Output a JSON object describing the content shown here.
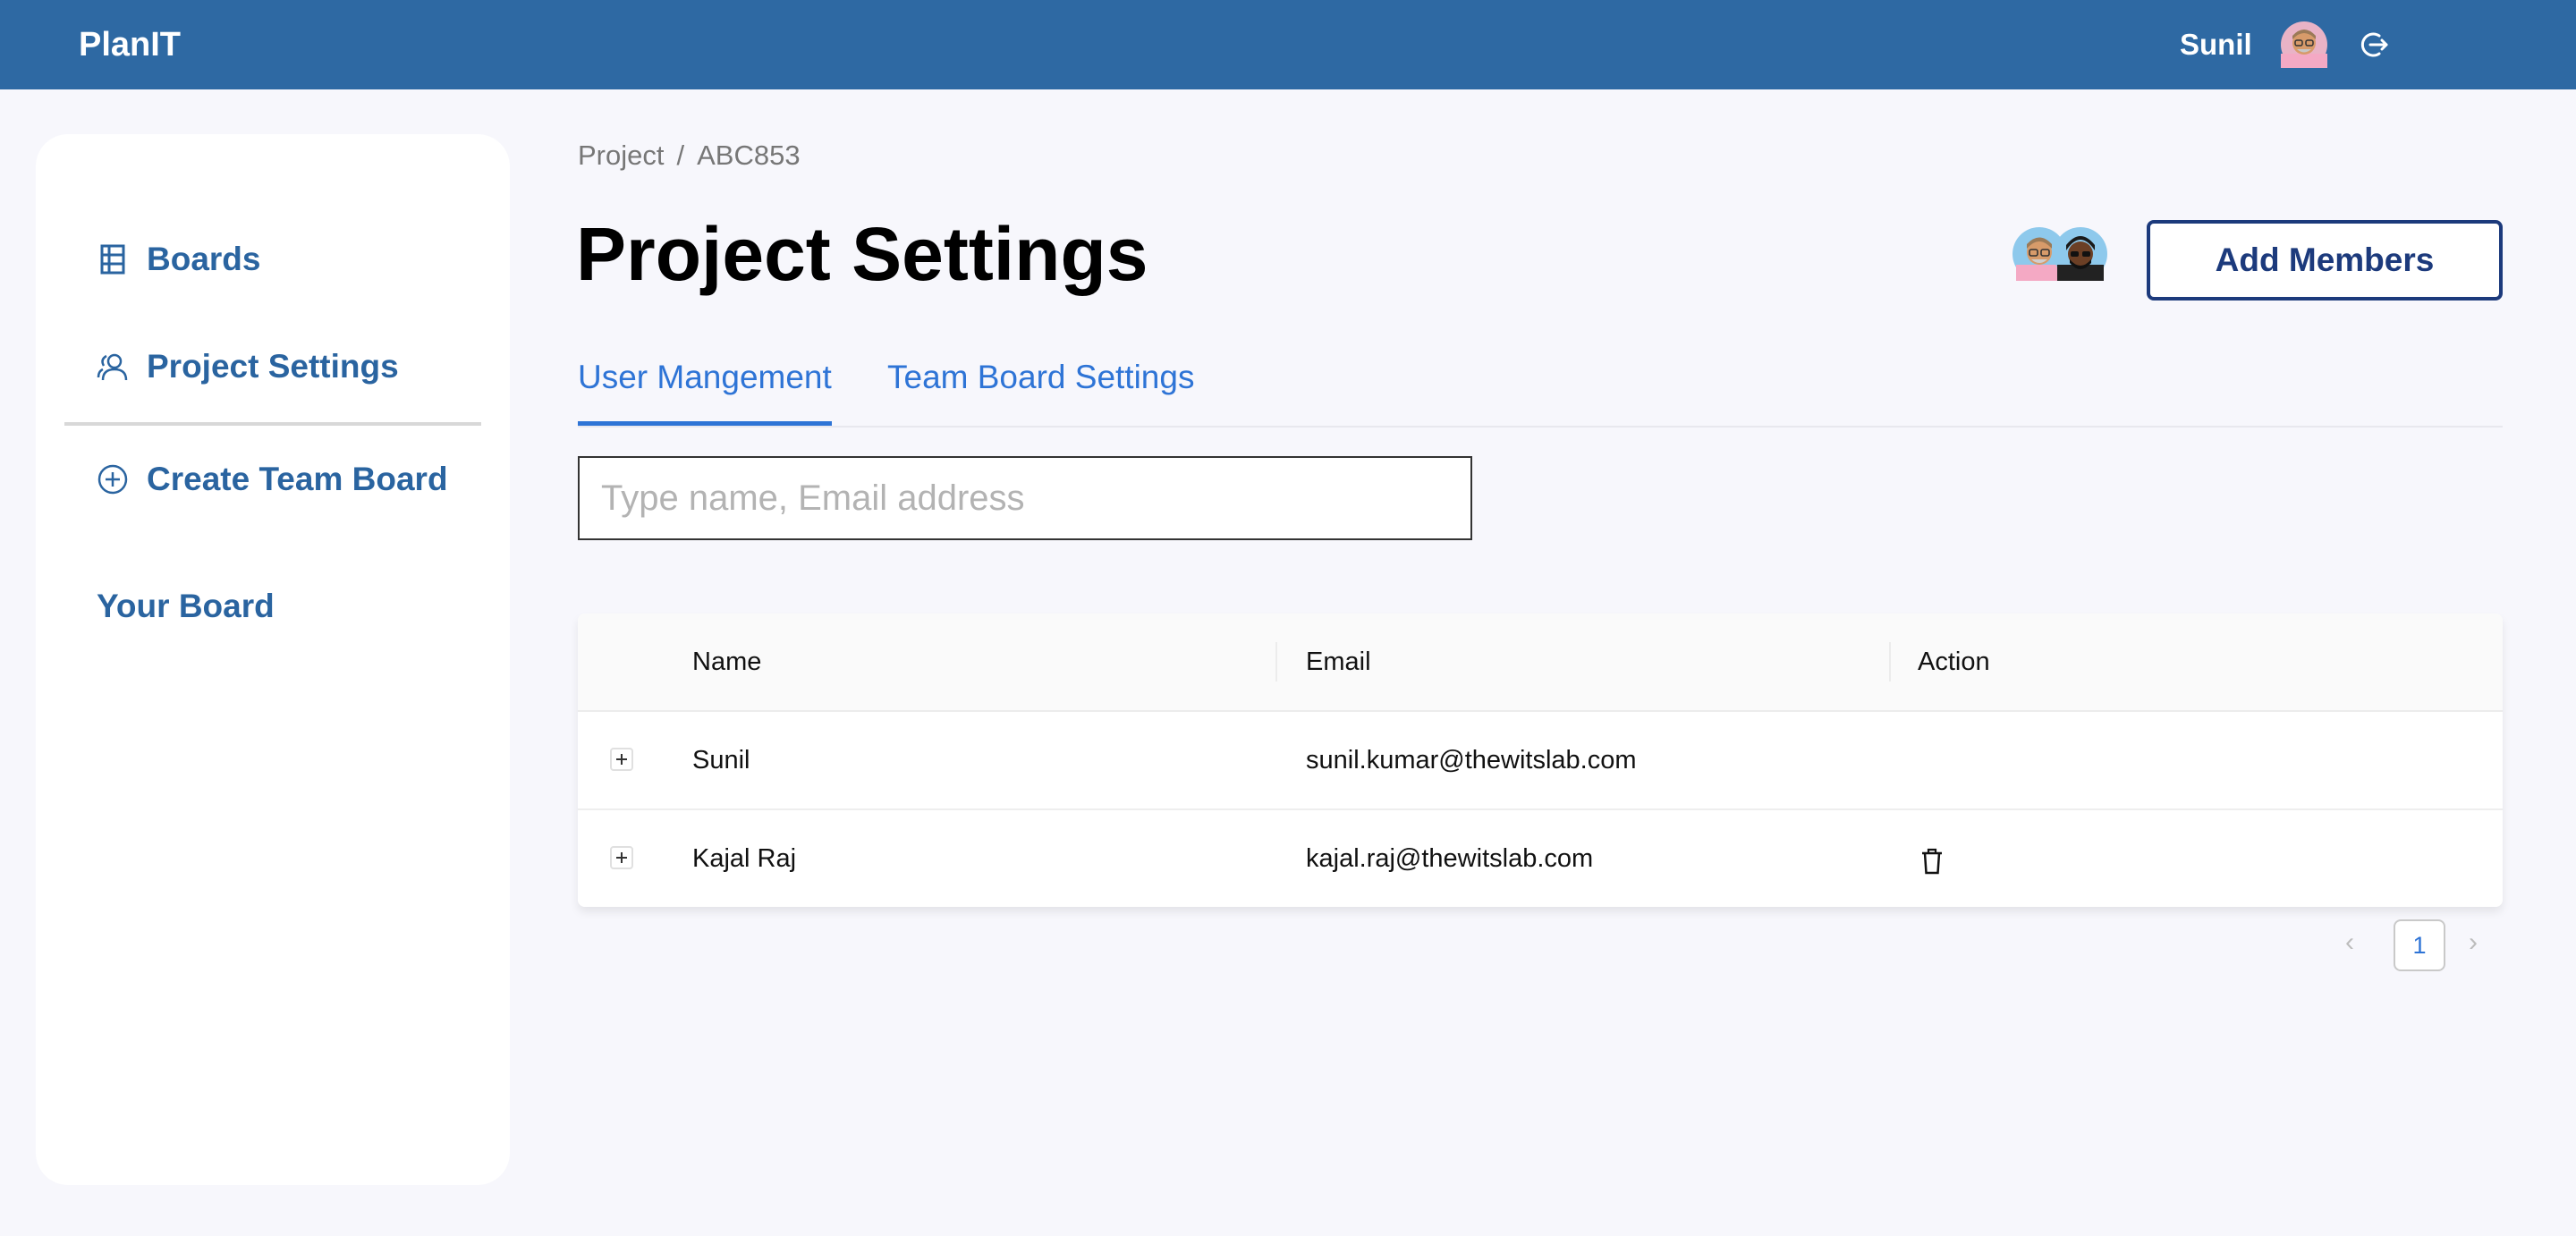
{
  "app": {
    "name": "PlanIT"
  },
  "user": {
    "name": "Sunil"
  },
  "sidebar": {
    "items": [
      {
        "label": "Boards",
        "icon": "board-grid-icon"
      },
      {
        "label": "Project Settings",
        "icon": "users-icon"
      },
      {
        "label": "Create Team Board",
        "icon": "plus-circle-icon"
      }
    ],
    "section_label": "Your Board"
  },
  "breadcrumb": {
    "root": "Project",
    "separator": "/",
    "current": "ABC853"
  },
  "page": {
    "title": "Project Settings",
    "add_members_label": "Add Members"
  },
  "tabs": [
    {
      "label": "User Mangement",
      "active": true
    },
    {
      "label": "Team Board Settings",
      "active": false
    }
  ],
  "search": {
    "placeholder": "Type name, Email address",
    "value": ""
  },
  "table": {
    "headers": [
      "Name",
      "Email",
      "Action"
    ],
    "rows": [
      {
        "name": "Sunil",
        "email": "sunil.kumar@thewitslab.com",
        "can_delete": false
      },
      {
        "name": "Kajal Raj",
        "email": "kajal.raj@thewitslab.com",
        "can_delete": true
      }
    ]
  },
  "pagination": {
    "current_page": "1",
    "prev": "‹",
    "next": "›"
  },
  "colors": {
    "header_bg": "#2e69a3",
    "sidebar_text": "#2a64a0",
    "tab_accent": "#2e74d6",
    "button_border": "#1c3a7c",
    "page_bg": "#f7f7fc"
  }
}
